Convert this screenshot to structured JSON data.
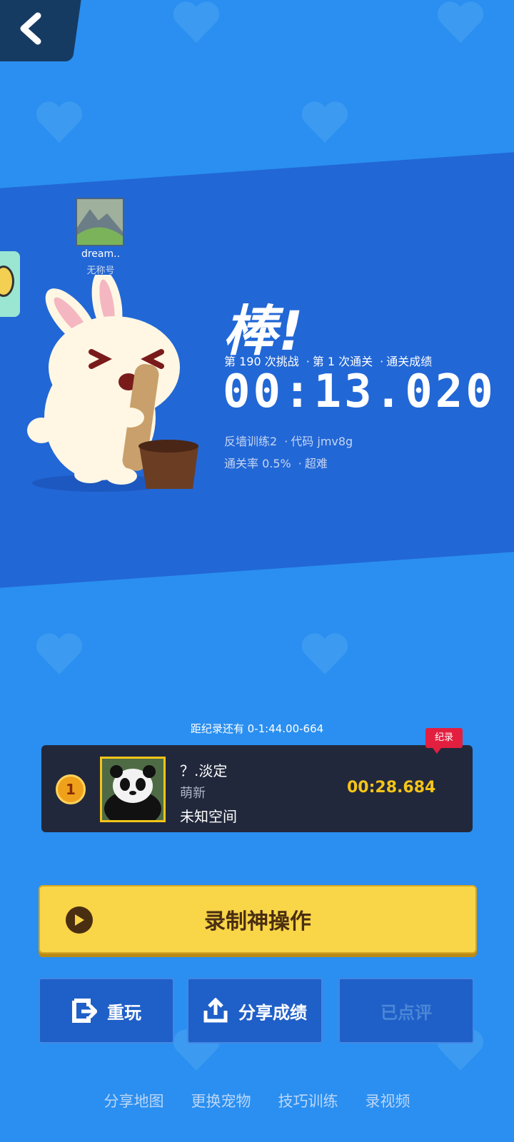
{
  "colors": {
    "background": "#2a8ff0",
    "band": "#2267d6",
    "record_card": "#22283c",
    "gold": "#f5c518",
    "record_button": "#f9d548",
    "record_tag": "#e21f3f"
  },
  "nav": {
    "back_icon": "chevron-left-icon"
  },
  "player": {
    "name": "dream..",
    "subtitle": "无称号"
  },
  "result": {
    "headline": "棒!",
    "challenge_count": "第 190 次挑战",
    "clear_count": "第 1 次通关",
    "clear_label": "通关成绩",
    "time": "00:13.020",
    "map_name": "反墙训练2",
    "map_code": "代码 jmv8g",
    "pass_rate": "通关率 0.5%",
    "difficulty": "超难"
  },
  "record": {
    "gap_text": "距纪录还有 0-1:44.00-664",
    "tag": "纪录",
    "rank": "1",
    "name": "？.淡定",
    "title": "萌新",
    "map": "未知空间",
    "time": "00:28.684"
  },
  "buttons": {
    "record_video": "录制神操作",
    "replay": "重玩",
    "share": "分享成绩",
    "rated": "已点评"
  },
  "bottom_links": [
    "分享地图",
    "更换宠物",
    "技巧训练",
    "录视频"
  ]
}
